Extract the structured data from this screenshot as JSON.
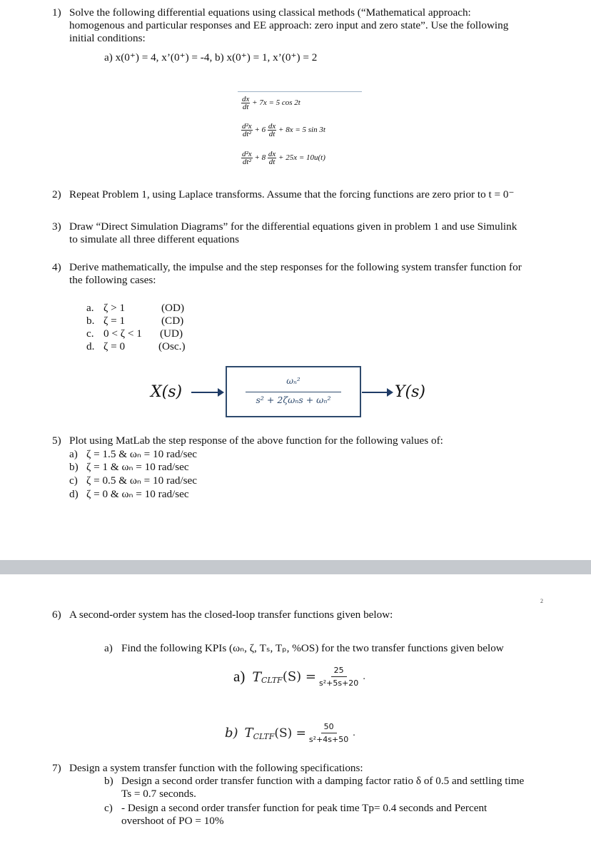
{
  "page1": {
    "q1": {
      "number": "1)",
      "lines": [
        "Solve the following differential equations using classical methods (“Mathematical approach:",
        "homogenous and particular responses and EE approach: zero input and zero state”.  Use the following",
        "initial conditions:"
      ],
      "conditions": "a)  x(0⁺) = 4, x’(0⁺) = -4, b) x(0⁺) = 1, x’(0⁺) = 2",
      "equations": [
        {
          "lhs_frac_num": "dx",
          "lhs_frac_den": "dt",
          "rest": "+ 7x = 5 cos 2t"
        },
        {
          "lhs_frac_num": "d²x",
          "lhs_frac_den": "dt²",
          "mid": "+ 6",
          "mid_frac_num": "dx",
          "mid_frac_den": "dt",
          "rest": "+ 8x = 5 sin 3t"
        },
        {
          "lhs_frac_num": "d²x",
          "lhs_frac_den": "dt²",
          "mid": "+ 8",
          "mid_frac_num": "dx",
          "mid_frac_den": "dt",
          "rest": "+ 25x = 10u(t)"
        }
      ]
    },
    "q2": {
      "number": "2)",
      "text": "Repeat Problem 1, using Laplace transforms.  Assume that the forcing functions are zero prior to t = 0⁻"
    },
    "q3": {
      "number": "3)",
      "lines": [
        "Draw “Direct Simulation Diagrams” for the differential equations given in problem 1 and use Simulink",
        "to simulate all three different equations"
      ]
    },
    "q4": {
      "number": "4)",
      "lines": [
        "Derive mathematically, the impulse and the step responses for the following system transfer function for",
        "the following cases:"
      ],
      "cases": [
        {
          "label": "a.",
          "cond": "ζ > 1",
          "type": "(OD)"
        },
        {
          "label": "b.",
          "cond": "ζ = 1",
          "type": "(CD)"
        },
        {
          "label": "c.",
          "cond": "0 < ζ < 1",
          "type": "(UD)"
        },
        {
          "label": "d.",
          "cond": "ζ = 0",
          "type": "(Osc.)"
        }
      ],
      "block_diagram": {
        "input": "X(s)",
        "output": "Y(s)",
        "numerator": "ωₙ²",
        "denominator": "s² + 2ζωₙs + ωₙ²"
      }
    },
    "q5": {
      "number": "5)",
      "text": "Plot using MatLab the step response of the above function for the following values of:",
      "items": [
        {
          "label": "a)",
          "text": "ζ = 1.5 & ωₙ = 10 rad/sec"
        },
        {
          "label": "b)",
          "text": "ζ = 1 & ωₙ = 10 rad/sec"
        },
        {
          "label": "c)",
          "text": "ζ = 0.5 & ωₙ = 10 rad/sec"
        },
        {
          "label": "d)",
          "text": "ζ = 0 & ωₙ = 10 rad/sec"
        }
      ]
    }
  },
  "page2": {
    "page_number": "2",
    "q6": {
      "number": "6)",
      "text": "A second-order system has the closed-loop transfer functions given below:",
      "sub_label": "a)",
      "sub_text": "Find the following KPIs (ωₙ, ζ, Tₛ, Tₚ, %OS) for the two transfer functions given below",
      "tf_a": {
        "label": "a)",
        "name": "T",
        "sub": "CLTF",
        "arg": "(S) =",
        "num": "25",
        "den": "s²+5s+20",
        "end": "."
      },
      "tf_b": {
        "label": "b)",
        "name": "T",
        "sub": "CLTF",
        "arg": "(S) =",
        "num": "50",
        "den": "s²+4s+50",
        "end": "."
      }
    },
    "q7": {
      "number": "7)",
      "text": "Design a system transfer function with the following specifications:",
      "items": [
        {
          "label": "b)",
          "lines": [
            "Design a second order transfer function with a damping factor ratio δ of 0.5 and settling time",
            "Ts = 0.7 seconds."
          ]
        },
        {
          "label": "c)",
          "lines": [
            "- Design a second order transfer function for peak time Tp= 0.4 seconds and Percent",
            "overshoot of PO = 10%"
          ]
        }
      ]
    }
  }
}
